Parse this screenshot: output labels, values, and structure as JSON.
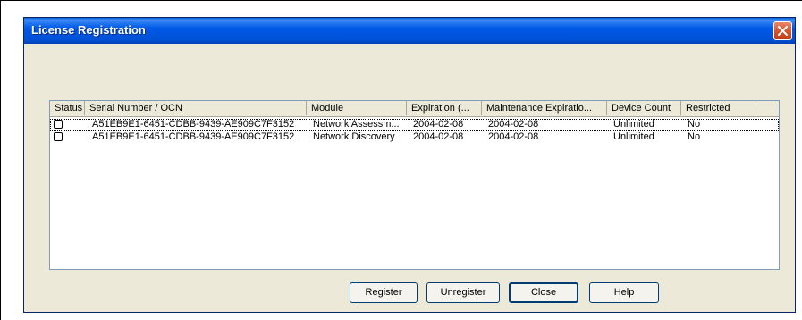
{
  "window": {
    "title": "License Registration"
  },
  "columns": [
    "Status",
    "Serial Number / OCN",
    "Module",
    "Expiration (...",
    "Maintenance Expiratio...",
    "Device Count",
    "Restricted"
  ],
  "rows": [
    {
      "status_checked": false,
      "serial": "A51EB9E1-6451-CDBB-9439-AE909C7F3152",
      "module": "Network Assessm...",
      "expiration": "2004-02-08",
      "maintenance_expiration": "2004-02-08",
      "device_count": "Unlimited",
      "restricted": "No"
    },
    {
      "status_checked": false,
      "serial": "A51EB9E1-6451-CDBB-9439-AE909C7F3152",
      "module": "Network Discovery",
      "expiration": "2004-02-08",
      "maintenance_expiration": "2004-02-08",
      "device_count": "Unlimited",
      "restricted": "No"
    }
  ],
  "buttons": {
    "register": "Register",
    "unregister": "Unregister",
    "close": "Close",
    "help": "Help"
  },
  "colors": {
    "titlebar": "#0058e6",
    "dialog_bg": "#ece9d8",
    "close_button": "#d8542c"
  }
}
